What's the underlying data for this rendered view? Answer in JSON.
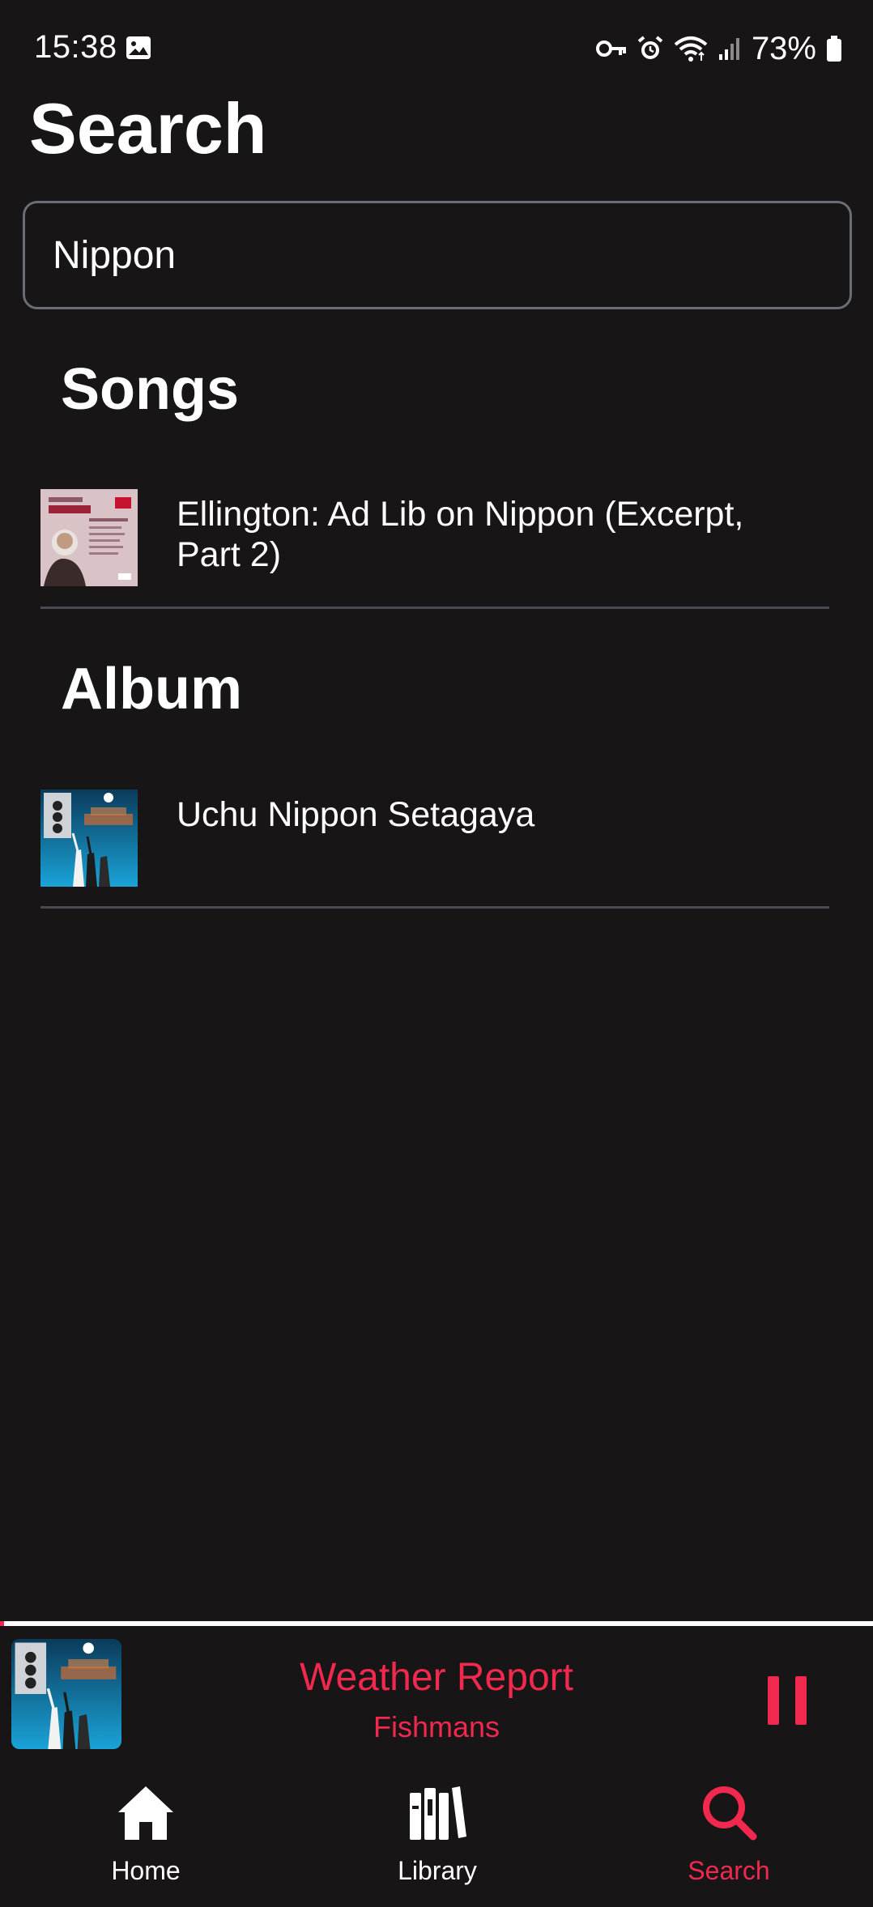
{
  "status_bar": {
    "time": "15:38",
    "battery": "73%"
  },
  "header": {
    "title": "Search"
  },
  "search": {
    "value": "Nippon",
    "placeholder": ""
  },
  "sections": {
    "songs": {
      "heading": "Songs",
      "items": [
        {
          "title": "Ellington: Ad Lib on Nippon (Excerpt, Part 2)"
        }
      ]
    },
    "album": {
      "heading": "Album",
      "items": [
        {
          "title": "Uchu Nippon Setagaya"
        }
      ]
    }
  },
  "now_playing": {
    "title": "Weather Report",
    "artist": "Fishmans",
    "progress": 0.005
  },
  "tabs": [
    {
      "label": "Home",
      "icon": "home-icon",
      "active": false
    },
    {
      "label": "Library",
      "icon": "library-icon",
      "active": false
    },
    {
      "label": "Search",
      "icon": "search-icon",
      "active": true
    }
  ],
  "colors": {
    "background": "#181516",
    "accent": "#f2294e",
    "text": "#ffffff",
    "divider": "#4a4b52",
    "input_border": "#6a6d76"
  }
}
